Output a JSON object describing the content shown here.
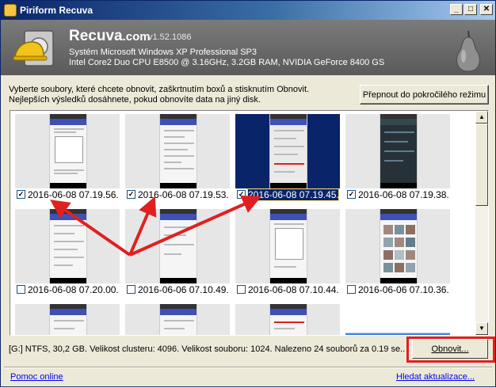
{
  "window": {
    "title": "Piriform Recuva",
    "controls": {
      "minimize": "_",
      "maximize": "□",
      "close": "✕"
    }
  },
  "header": {
    "brand": "Recuva",
    "brand_suffix": ".com",
    "version": "v1.52.1086",
    "os_line": "Systém Microsoft Windows XP Professional SP3",
    "hw_line": "Intel Core2 Duo CPU E8500 @ 3.16GHz, 3.2GB RAM, NVIDIA GeForce 8400 GS",
    "logo_icon": "hard-drive-helmet-icon",
    "pear_icon": "pear-icon"
  },
  "instructions": {
    "line1": "Vyberte soubory, které chcete obnovit, zaškrtnutím boxů a stisknutím Obnovit.",
    "line2": "Nejlepších výsledků dosáhnete, pokud obnovíte data na jiný disk."
  },
  "advanced_button": "Přepnout do pokročilého režimu",
  "gallery": {
    "rows": [
      [
        {
          "caption": "2016-06-08 07.19.56...",
          "checked": true,
          "selected": false,
          "check_mark": "✓"
        },
        {
          "caption": "2016-06-08 07.19.53...",
          "checked": true,
          "selected": false,
          "check_mark": "✓"
        },
        {
          "caption": "2016-06-08 07.19.45...",
          "checked": true,
          "selected": true,
          "check_mark": "✓"
        },
        {
          "caption": "2016-06-08 07.19.38...",
          "checked": true,
          "selected": false,
          "check_mark": "✓"
        }
      ],
      [
        {
          "caption": "2016-06-08 07.20.00...",
          "checked": false,
          "selected": false,
          "check_mark": ""
        },
        {
          "caption": "2016-06-06 07.10.49...",
          "checked": false,
          "selected": false,
          "check_mark": ""
        },
        {
          "caption": "2016-06-08 07.10.44...",
          "checked": false,
          "selected": false,
          "check_mark": ""
        },
        {
          "caption": "2016-06-06 07.10.36...",
          "checked": false,
          "selected": false,
          "check_mark": ""
        }
      ]
    ],
    "scroll_up_icon": "▲",
    "scroll_down_icon": "▼"
  },
  "status": {
    "text": "[G:] NTFS, 30,2 GB. Velikost clusteru: 4096. Velikost souboru: 1024. Nalezeno 24 souborů za 0.19 se..."
  },
  "recover_button": "Obnovit...",
  "footer": {
    "help_link": "Pomoc online",
    "update_link": "Hledat aktualizace..."
  },
  "annotation_color": "#e02020"
}
